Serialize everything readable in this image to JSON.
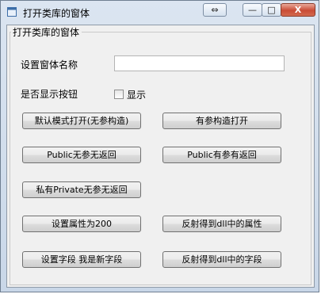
{
  "window": {
    "title": "打开类库的窗体",
    "controls": {
      "swap": "⇔",
      "minimize": "—",
      "maximize": "□",
      "close": "X"
    }
  },
  "group": {
    "legend": "打开类库的窗体"
  },
  "form": {
    "name_label": "设置窗体名称",
    "name_value": "",
    "show_button_label": "是否显示按钮",
    "show_checkbox_label": "显示",
    "show_checked": false
  },
  "buttons": {
    "default_open": "默认模式打开(无参构造)",
    "param_open": "有参构造打开",
    "public_no_param": "Public无参无返回",
    "public_param_return": "Public有参有返回",
    "private_no_param": "私有Private无参无返回",
    "set_property": "设置属性为200",
    "reflect_property": "反射得到dll中的属性",
    "set_field": "设置字段 我是新字段",
    "reflect_field": "反射得到dll中的字段"
  }
}
